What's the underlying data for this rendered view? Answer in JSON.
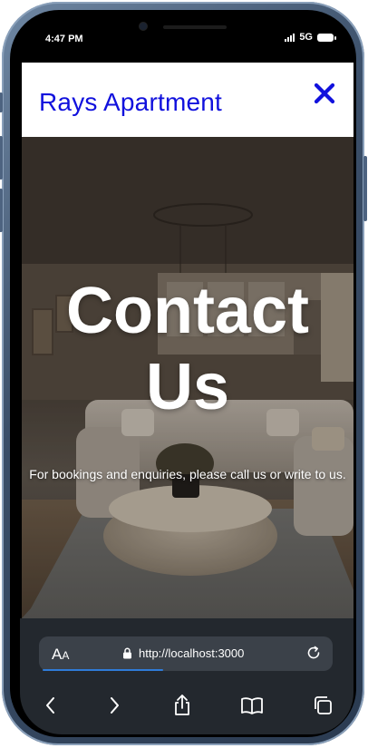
{
  "status": {
    "time": "4:47 PM",
    "network": "5G",
    "signal_bars": 4
  },
  "header": {
    "brand": "Rays Apartment",
    "brand_color": "#1111dd",
    "close_icon": "close-icon"
  },
  "hero": {
    "title": "Contact Us",
    "subtitle": "For bookings and enquiries, please call us or write to us.",
    "background": "living-room-photo"
  },
  "browser": {
    "text_size_label": "A",
    "text_size_label_small": "A",
    "url": "http://localhost:3000",
    "load_progress": 0.42,
    "accent": "#2f7bd8",
    "icons": [
      "back-icon",
      "forward-icon",
      "share-icon",
      "bookmarks-icon",
      "tabs-icon"
    ]
  }
}
